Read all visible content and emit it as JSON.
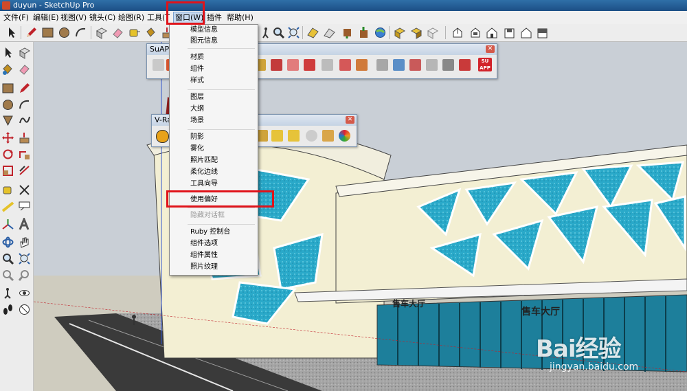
{
  "window": {
    "title": "duyun - SketchUp Pro"
  },
  "menubar": {
    "items": [
      {
        "label": "文件(F)"
      },
      {
        "label": "编辑(E)"
      },
      {
        "label": "视图(V)"
      },
      {
        "label": "镜头(C)"
      },
      {
        "label": "绘图(R)"
      },
      {
        "label": "工具(T"
      },
      {
        "label": "窗口(W)"
      },
      {
        "label": "插件"
      },
      {
        "label": "帮助(H)"
      }
    ]
  },
  "toolbars": {
    "suapp": {
      "title": "SuAPP"
    },
    "vray": {
      "title": "V-Ray"
    }
  },
  "dropdown": {
    "groups": [
      [
        "模型信息",
        "图元信息"
      ],
      [
        "材质",
        "组件",
        "样式"
      ],
      [
        "图层",
        "大纲",
        "场景"
      ],
      [
        "阴影",
        "雾化",
        "照片匹配",
        "柔化边线",
        "工具向导"
      ],
      [
        "使用偏好"
      ],
      [
        "隐藏对话框"
      ],
      [
        "Ruby 控制台",
        "组件选项",
        "组件属性",
        "照片纹理"
      ]
    ],
    "disabled_item": "隐藏对话框",
    "highlighted_item": "使用偏好"
  },
  "scene": {
    "signs": [
      "售车大厅",
      "售车大厅"
    ]
  },
  "watermark": {
    "logo": "Bai经验",
    "url": "jingyan.baidu.com"
  },
  "colors": {
    "highlight_box": "#e0131a",
    "titlebar": "#2f6fa7",
    "glass": "#2aa9c9",
    "facade": "#f3efd3",
    "sky": "#c9cfd6"
  }
}
